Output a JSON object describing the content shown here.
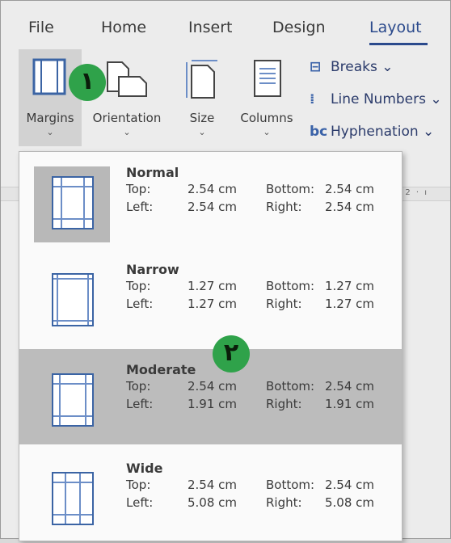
{
  "tabs": [
    {
      "label": "File",
      "active": false
    },
    {
      "label": "Home",
      "active": false
    },
    {
      "label": "Insert",
      "active": false
    },
    {
      "label": "Design",
      "active": false
    },
    {
      "label": "Layout",
      "active": true
    }
  ],
  "ribbon": {
    "margins": "Margins",
    "orientation": "Orientation",
    "size": "Size",
    "columns": "Columns",
    "breaks": "Breaks",
    "line_numbers": "Line Numbers",
    "hyphenation": "Hyphenation"
  },
  "ruler_text": "· 2 · ı",
  "badges": [
    "١",
    "٢"
  ],
  "margin_options": [
    {
      "name": "Normal",
      "top_label": "Top:",
      "top": "2.54 cm",
      "bottom_label": "Bottom:",
      "bottom": "2.54 cm",
      "left_label": "Left:",
      "left": "2.54 cm",
      "right_label": "Right:",
      "right": "2.54 cm"
    },
    {
      "name": "Narrow",
      "top_label": "Top:",
      "top": "1.27 cm",
      "bottom_label": "Bottom:",
      "bottom": "1.27 cm",
      "left_label": "Left:",
      "left": "1.27 cm",
      "right_label": "Right:",
      "right": "1.27 cm"
    },
    {
      "name": "Moderate",
      "top_label": "Top:",
      "top": "2.54 cm",
      "bottom_label": "Bottom:",
      "bottom": "2.54 cm",
      "left_label": "Left:",
      "left": "1.91 cm",
      "right_label": "Right:",
      "right": "1.91 cm"
    },
    {
      "name": "Wide",
      "top_label": "Top:",
      "top": "2.54 cm",
      "bottom_label": "Bottom:",
      "bottom": "2.54 cm",
      "left_label": "Left:",
      "left": "5.08 cm",
      "right_label": "Right:",
      "right": "5.08 cm"
    }
  ],
  "colors": {
    "accent": "#2b4a8c",
    "badge": "#2fa24a",
    "page_border": "#3b64a4"
  }
}
